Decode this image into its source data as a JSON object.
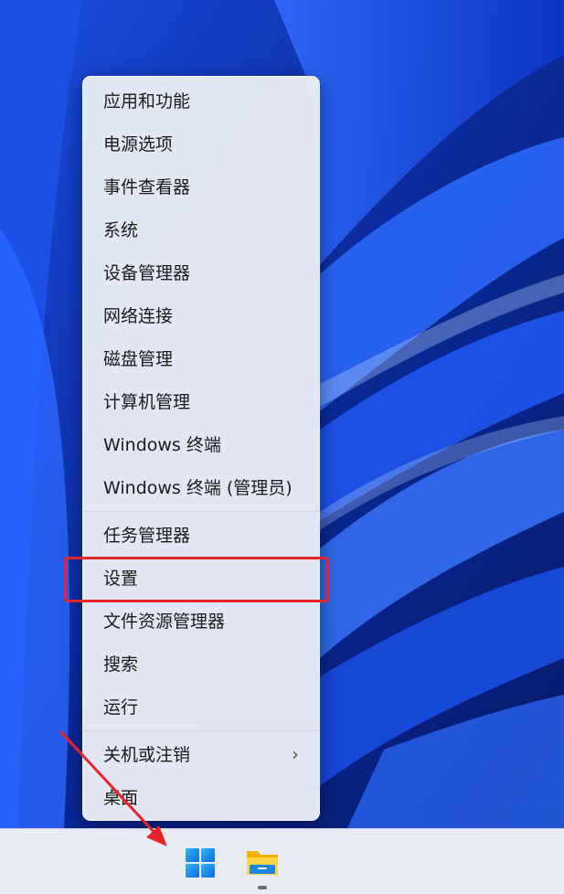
{
  "menu": {
    "items": [
      {
        "label": "应用和功能"
      },
      {
        "label": "电源选项"
      },
      {
        "label": "事件查看器"
      },
      {
        "label": "系统"
      },
      {
        "label": "设备管理器"
      },
      {
        "label": "网络连接"
      },
      {
        "label": "磁盘管理"
      },
      {
        "label": "计算机管理"
      },
      {
        "label": "Windows 终端"
      },
      {
        "label": "Windows 终端 (管理员)"
      },
      {
        "label": "任务管理器"
      },
      {
        "label": "设置"
      },
      {
        "label": "文件资源管理器"
      },
      {
        "label": "搜索"
      },
      {
        "label": "运行"
      },
      {
        "label": "关机或注销",
        "submenu_icon": "chevron-right-icon"
      },
      {
        "label": "桌面"
      }
    ],
    "highlighted_item": "设置",
    "highlight_color": "#e8242b"
  },
  "taskbar": {
    "icons": [
      "windows-start-icon",
      "file-explorer-icon"
    ],
    "background": "#e8ebf4"
  },
  "annotation_arrow_color": "#e8242b"
}
